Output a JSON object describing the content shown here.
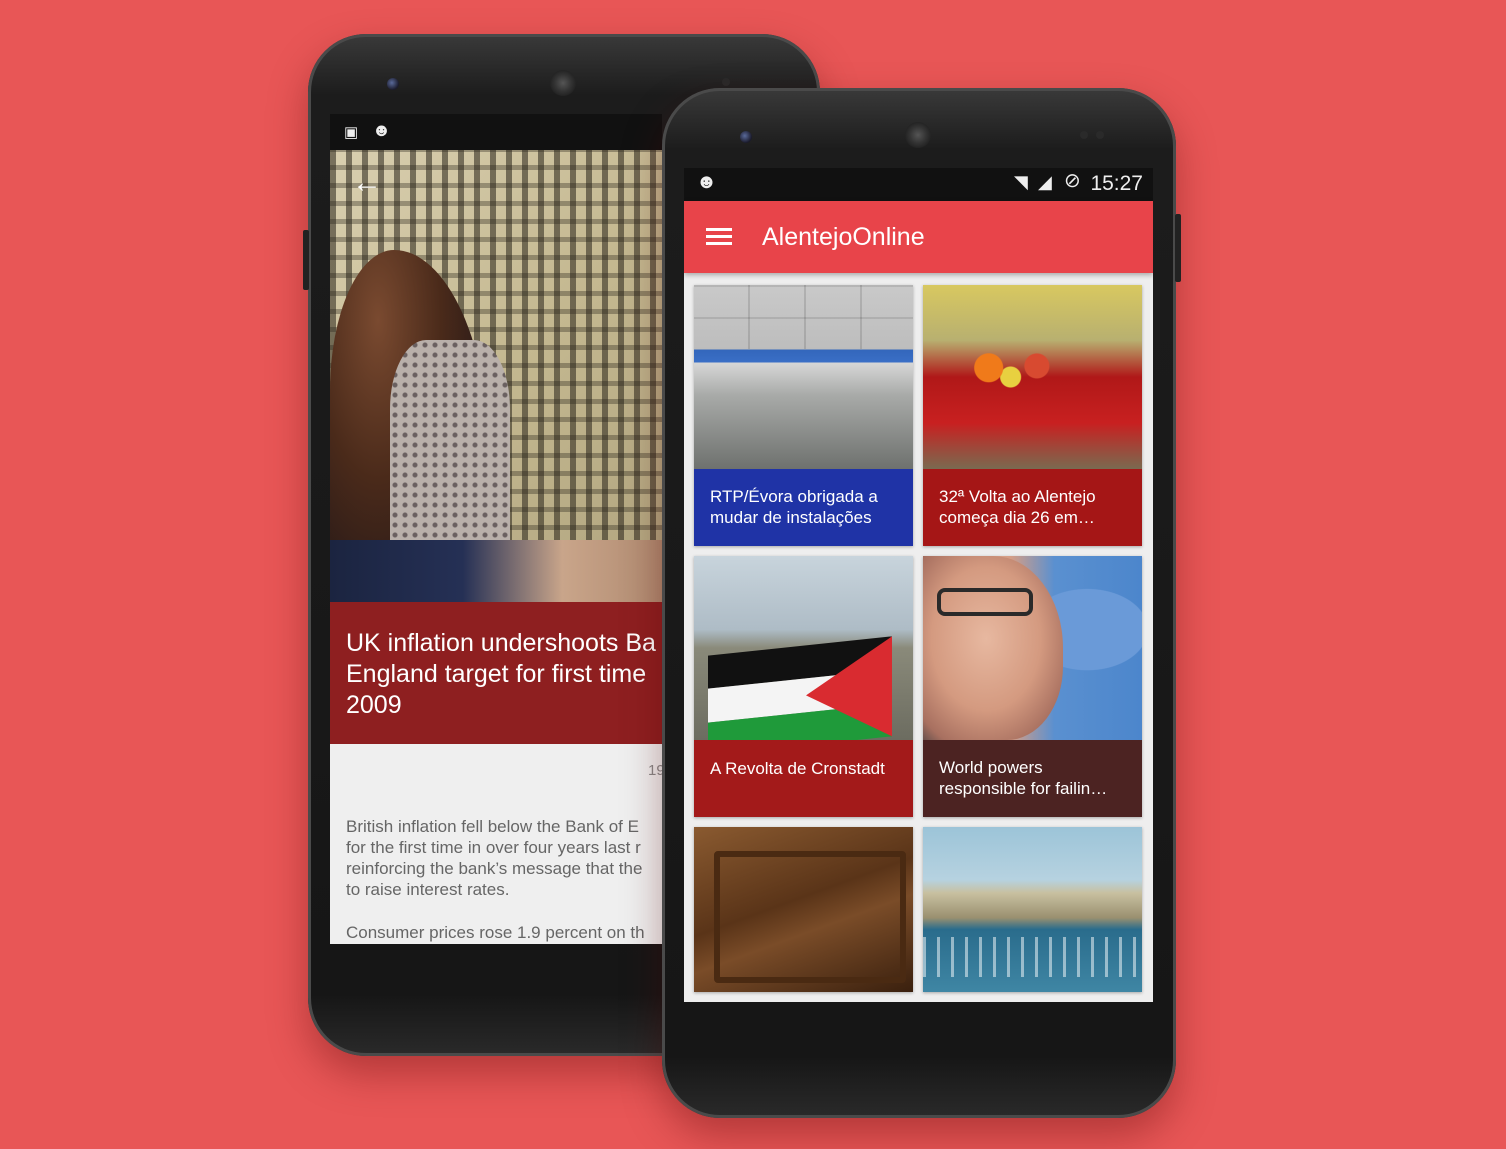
{
  "back_screen": {
    "status_icons": [
      "image-icon",
      "cyanogen-icon"
    ],
    "article": {
      "title": "UK inflation undershoots Ba\nEngland target for first time\n2009",
      "date": "19",
      "body_paragraph_1": "British inflation fell below the Bank of E\nfor the first time in over four years last r\nreinforcing the bank’s message that the\nto raise interest rates.",
      "body_paragraph_2": "Consumer prices rose 1.9 percent on th"
    },
    "colors": {
      "title_block": "#8e1f20"
    }
  },
  "front_screen": {
    "status": {
      "time": "15:27",
      "icons": [
        "cyanogen-icon",
        "wifi-icon",
        "signal-icon",
        "battery-charging-icon"
      ]
    },
    "app_bar": {
      "title": "AlentejoOnline",
      "menu_icon": "hamburger-menu-icon"
    },
    "cards": [
      {
        "line1": "RTP/Évora obrigada a",
        "line2": "mudar de instalações",
        "color": "#1f33a6"
      },
      {
        "line1": "32ª Volta ao Alentejo",
        "line2": "começa dia 26 em…",
        "color": "#a51616"
      },
      {
        "line1": "A Revolta de Cronstadt",
        "line2": "",
        "color": "#a31a1a"
      },
      {
        "line1": "World powers",
        "line2": "responsible for failin…",
        "color": "#4c2322"
      },
      {
        "line1": "",
        "line2": "",
        "color": ""
      },
      {
        "line1": "",
        "line2": "",
        "color": ""
      }
    ],
    "colors": {
      "app_bar": "#e8444a",
      "background": "#eeeeee"
    }
  },
  "colors": {
    "page_background": "#e85656"
  }
}
